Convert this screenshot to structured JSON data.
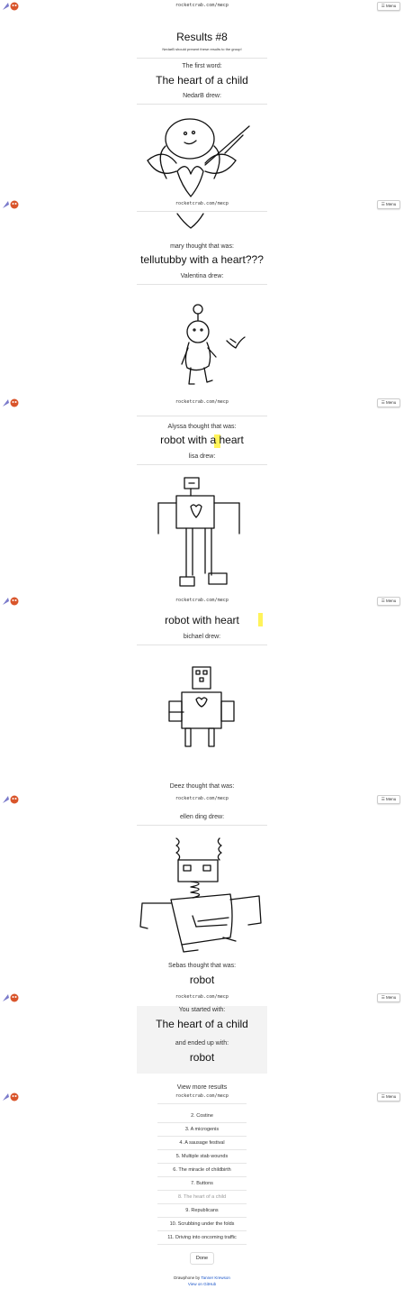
{
  "header": {
    "url": "rocketcrab.com/mecp",
    "menu_label": "☰ Menu"
  },
  "results": {
    "title": "Results #8",
    "subtitle": "NedarB should present these results to the group!",
    "first_word_label": "The first word:",
    "first_word": "The heart of a child",
    "steps": [
      {
        "drew_label": "NedarB drew:"
      },
      {
        "thought_label": "mary thought that was:",
        "guess": "tellutubby with a heart???",
        "drew_label": "Valentina drew:"
      },
      {
        "thought_label": "Alyssa thought that was:",
        "guess": "robot with a heart",
        "drew_label": "lisa drew:"
      },
      {
        "guess": "robot with heart",
        "drew_label": "bichael drew:"
      },
      {
        "thought_label": "Deez thought that was:",
        "drew_label": "ellen ding drew:"
      },
      {
        "thought_label": "Sebas thought that was:",
        "guess": "robot"
      }
    ]
  },
  "summary": {
    "started_label": "You started with:",
    "start_word": "The heart of a child",
    "ended_label": "and ended up with:",
    "end_word": "robot"
  },
  "view_more_label": "View more results",
  "rounds": [
    "2. Costine",
    "3. A microgenis",
    "4. A sausage festival",
    "5. Multiple stab wounds",
    "6. The miracle of childbirth",
    "7. Buttons",
    "8. The heart of a child",
    "9. Republicans",
    "10. Scrubbing under the folds",
    "11. Driving into oncoming traffic"
  ],
  "done_label": "Done",
  "footer": {
    "line1_prefix": "Drawphone by",
    "line1_link": "Tanner Krewson",
    "line2_link": "View on GitHub"
  },
  "colors": {
    "highlight": "#fff35a",
    "summary_bg": "#f3f3f3",
    "link": "#1a55c9"
  }
}
